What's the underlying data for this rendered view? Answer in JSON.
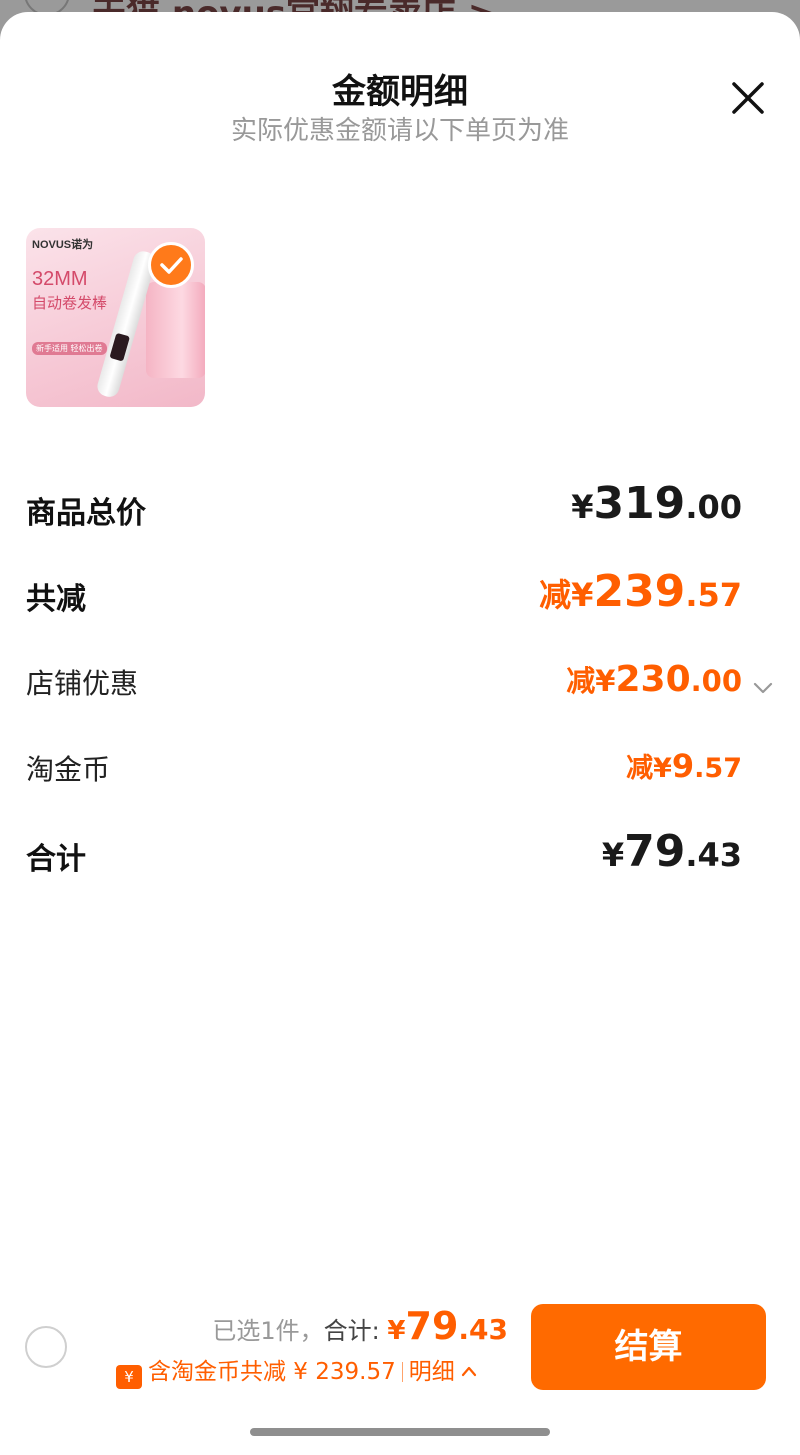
{
  "backdrop": {
    "store_name": "天猫 novus官翔专卖店 >"
  },
  "sheet": {
    "title": "金额明细",
    "subtitle": "实际优惠金额请以下单页为准"
  },
  "product": {
    "brand": "NOVUS诺为",
    "spec": "32MM",
    "name": "自动卷发棒",
    "tag": "新手适用 轻松出卷",
    "selected": true
  },
  "rows": {
    "goods_total": {
      "label": "商品总价",
      "currency": "¥",
      "int": "319",
      "dec": ".00"
    },
    "total_reduction": {
      "label": "共减",
      "prefix": "减¥",
      "int": "239",
      "dec": ".57"
    },
    "store_discount": {
      "label": "店铺优惠",
      "prefix": "减¥",
      "int": "230",
      "dec": ".00"
    },
    "taojinbi": {
      "label": "淘金币",
      "prefix": "减¥",
      "int": "9",
      "dec": ".57"
    },
    "sum": {
      "label": "合计",
      "currency": "¥",
      "int": "79",
      "dec": ".43"
    }
  },
  "footer": {
    "selected_text": "已选1件，",
    "total_label": "合计:",
    "total_currency": "¥",
    "total_int": "79",
    "total_dec": ".43",
    "coin_icon_glyph": "¥",
    "discount_text": "含淘金币共减 ¥ 239.57",
    "detail_label": "明细",
    "checkout_label": "结算"
  },
  "colors": {
    "accent": "#ff5e00",
    "button": "#ff6a00",
    "text": "#1a1a1a"
  }
}
